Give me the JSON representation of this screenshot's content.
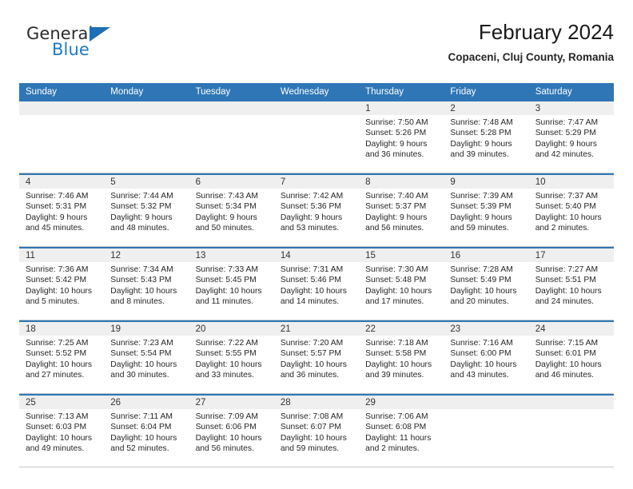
{
  "brand": {
    "name_top": "General",
    "name_bottom": "Blue",
    "triangle_color": "#1f6fb8",
    "blue_color": "#1f7ac4"
  },
  "header": {
    "title": "February 2024",
    "subtitle": "Copaceni, Cluj County, Romania"
  },
  "theme": {
    "header_blue": "#2f76b6",
    "daynum_band": "#efefef",
    "row_rule": "#c9c9c9"
  },
  "weekday_headers": [
    "Sunday",
    "Monday",
    "Tuesday",
    "Wednesday",
    "Thursday",
    "Friday",
    "Saturday"
  ],
  "weeks": [
    [
      {
        "day": "",
        "lines": []
      },
      {
        "day": "",
        "lines": []
      },
      {
        "day": "",
        "lines": []
      },
      {
        "day": "",
        "lines": []
      },
      {
        "day": "1",
        "lines": [
          "Sunrise: 7:50 AM",
          "Sunset: 5:26 PM",
          "Daylight: 9 hours",
          "and 36 minutes."
        ]
      },
      {
        "day": "2",
        "lines": [
          "Sunrise: 7:48 AM",
          "Sunset: 5:28 PM",
          "Daylight: 9 hours",
          "and 39 minutes."
        ]
      },
      {
        "day": "3",
        "lines": [
          "Sunrise: 7:47 AM",
          "Sunset: 5:29 PM",
          "Daylight: 9 hours",
          "and 42 minutes."
        ]
      }
    ],
    [
      {
        "day": "4",
        "lines": [
          "Sunrise: 7:46 AM",
          "Sunset: 5:31 PM",
          "Daylight: 9 hours",
          "and 45 minutes."
        ]
      },
      {
        "day": "5",
        "lines": [
          "Sunrise: 7:44 AM",
          "Sunset: 5:32 PM",
          "Daylight: 9 hours",
          "and 48 minutes."
        ]
      },
      {
        "day": "6",
        "lines": [
          "Sunrise: 7:43 AM",
          "Sunset: 5:34 PM",
          "Daylight: 9 hours",
          "and 50 minutes."
        ]
      },
      {
        "day": "7",
        "lines": [
          "Sunrise: 7:42 AM",
          "Sunset: 5:36 PM",
          "Daylight: 9 hours",
          "and 53 minutes."
        ]
      },
      {
        "day": "8",
        "lines": [
          "Sunrise: 7:40 AM",
          "Sunset: 5:37 PM",
          "Daylight: 9 hours",
          "and 56 minutes."
        ]
      },
      {
        "day": "9",
        "lines": [
          "Sunrise: 7:39 AM",
          "Sunset: 5:39 PM",
          "Daylight: 9 hours",
          "and 59 minutes."
        ]
      },
      {
        "day": "10",
        "lines": [
          "Sunrise: 7:37 AM",
          "Sunset: 5:40 PM",
          "Daylight: 10 hours",
          "and 2 minutes."
        ]
      }
    ],
    [
      {
        "day": "11",
        "lines": [
          "Sunrise: 7:36 AM",
          "Sunset: 5:42 PM",
          "Daylight: 10 hours",
          "and 5 minutes."
        ]
      },
      {
        "day": "12",
        "lines": [
          "Sunrise: 7:34 AM",
          "Sunset: 5:43 PM",
          "Daylight: 10 hours",
          "and 8 minutes."
        ]
      },
      {
        "day": "13",
        "lines": [
          "Sunrise: 7:33 AM",
          "Sunset: 5:45 PM",
          "Daylight: 10 hours",
          "and 11 minutes."
        ]
      },
      {
        "day": "14",
        "lines": [
          "Sunrise: 7:31 AM",
          "Sunset: 5:46 PM",
          "Daylight: 10 hours",
          "and 14 minutes."
        ]
      },
      {
        "day": "15",
        "lines": [
          "Sunrise: 7:30 AM",
          "Sunset: 5:48 PM",
          "Daylight: 10 hours",
          "and 17 minutes."
        ]
      },
      {
        "day": "16",
        "lines": [
          "Sunrise: 7:28 AM",
          "Sunset: 5:49 PM",
          "Daylight: 10 hours",
          "and 20 minutes."
        ]
      },
      {
        "day": "17",
        "lines": [
          "Sunrise: 7:27 AM",
          "Sunset: 5:51 PM",
          "Daylight: 10 hours",
          "and 24 minutes."
        ]
      }
    ],
    [
      {
        "day": "18",
        "lines": [
          "Sunrise: 7:25 AM",
          "Sunset: 5:52 PM",
          "Daylight: 10 hours",
          "and 27 minutes."
        ]
      },
      {
        "day": "19",
        "lines": [
          "Sunrise: 7:23 AM",
          "Sunset: 5:54 PM",
          "Daylight: 10 hours",
          "and 30 minutes."
        ]
      },
      {
        "day": "20",
        "lines": [
          "Sunrise: 7:22 AM",
          "Sunset: 5:55 PM",
          "Daylight: 10 hours",
          "and 33 minutes."
        ]
      },
      {
        "day": "21",
        "lines": [
          "Sunrise: 7:20 AM",
          "Sunset: 5:57 PM",
          "Daylight: 10 hours",
          "and 36 minutes."
        ]
      },
      {
        "day": "22",
        "lines": [
          "Sunrise: 7:18 AM",
          "Sunset: 5:58 PM",
          "Daylight: 10 hours",
          "and 39 minutes."
        ]
      },
      {
        "day": "23",
        "lines": [
          "Sunrise: 7:16 AM",
          "Sunset: 6:00 PM",
          "Daylight: 10 hours",
          "and 43 minutes."
        ]
      },
      {
        "day": "24",
        "lines": [
          "Sunrise: 7:15 AM",
          "Sunset: 6:01 PM",
          "Daylight: 10 hours",
          "and 46 minutes."
        ]
      }
    ],
    [
      {
        "day": "25",
        "lines": [
          "Sunrise: 7:13 AM",
          "Sunset: 6:03 PM",
          "Daylight: 10 hours",
          "and 49 minutes."
        ]
      },
      {
        "day": "26",
        "lines": [
          "Sunrise: 7:11 AM",
          "Sunset: 6:04 PM",
          "Daylight: 10 hours",
          "and 52 minutes."
        ]
      },
      {
        "day": "27",
        "lines": [
          "Sunrise: 7:09 AM",
          "Sunset: 6:06 PM",
          "Daylight: 10 hours",
          "and 56 minutes."
        ]
      },
      {
        "day": "28",
        "lines": [
          "Sunrise: 7:08 AM",
          "Sunset: 6:07 PM",
          "Daylight: 10 hours",
          "and 59 minutes."
        ]
      },
      {
        "day": "29",
        "lines": [
          "Sunrise: 7:06 AM",
          "Sunset: 6:08 PM",
          "Daylight: 11 hours",
          "and 2 minutes."
        ]
      },
      {
        "day": "",
        "lines": []
      },
      {
        "day": "",
        "lines": []
      }
    ]
  ]
}
